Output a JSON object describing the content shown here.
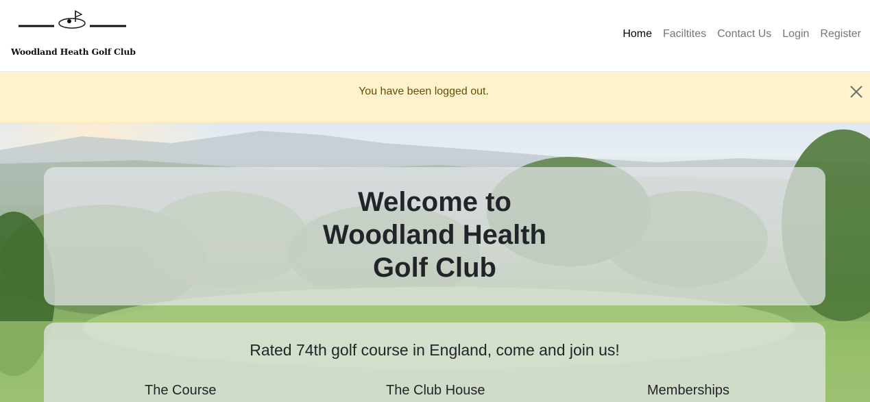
{
  "brand": {
    "name": "Woodland Heath Golf Club",
    "logo": "golf-flag-hole-logo"
  },
  "nav": {
    "items": [
      {
        "label": "Home",
        "active": true
      },
      {
        "label": "Faciltites",
        "active": false
      },
      {
        "label": "Contact Us",
        "active": false
      },
      {
        "label": "Login",
        "active": false
      },
      {
        "label": "Register",
        "active": false
      }
    ]
  },
  "alert": {
    "message": "You have been logged out.",
    "close_icon": "close-icon",
    "color": "#fff3cd",
    "text_color": "#664d03"
  },
  "hero": {
    "title_lines": [
      "Welcome to",
      "Woodland Health",
      "Golf Club"
    ],
    "tagline": "Rated 74th golf course in England, come and join us!",
    "features": [
      "The Course",
      "The Club House",
      "Memberships"
    ]
  }
}
